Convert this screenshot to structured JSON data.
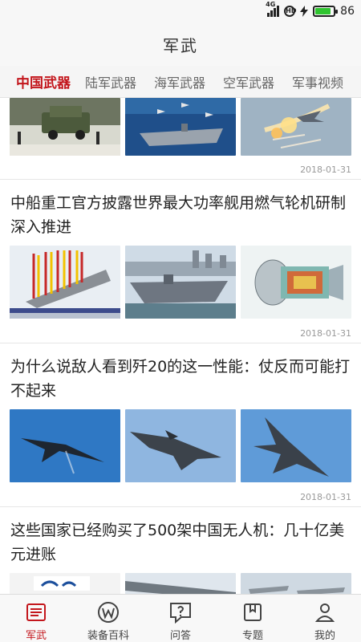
{
  "status_bar": {
    "network": "4G",
    "hd_badge": "HD",
    "battery": "86",
    "battery_level": 0.86
  },
  "header": {
    "title": "军武"
  },
  "tabs": [
    {
      "label": "中国武器",
      "active": true
    },
    {
      "label": "陆军武器"
    },
    {
      "label": "海军武器"
    },
    {
      "label": "空军武器"
    },
    {
      "label": "军事视频"
    }
  ],
  "articles": [
    {
      "title": "",
      "date": "2018-01-31",
      "images": [
        "army-vehicles-parade",
        "aircraft-carrier-with-jets",
        "fighter-jet-firing-flares"
      ]
    },
    {
      "title": "中船重工官方披露世界最大功率舰用燃气轮机研制深入推进",
      "date": "2018-01-31",
      "images": [
        "carrier-launch-ceremony",
        "carrier-at-dock",
        "gas-turbine-cutaway"
      ]
    },
    {
      "title": "为什么说敌人看到歼20的这一性能：仗反而可能打不起来",
      "date": "2018-01-31",
      "images": [
        "j20-banking",
        "j20-flight-side",
        "j20-top-view"
      ]
    },
    {
      "title": "这些国家已经购买了500架中国无人机：几十亿美元进账",
      "date": "",
      "images": [
        "wing-loong-drone",
        "drone-wing-closeup",
        "drones-on-airfield"
      ]
    }
  ],
  "bottom_nav": [
    {
      "label": "军武",
      "icon": "news-list-icon",
      "active": true
    },
    {
      "label": "装备百科",
      "icon": "wiki-w-icon"
    },
    {
      "label": "问答",
      "icon": "question-bubble-icon"
    },
    {
      "label": "专题",
      "icon": "bookmark-icon"
    },
    {
      "label": "我的",
      "icon": "user-icon"
    }
  ]
}
